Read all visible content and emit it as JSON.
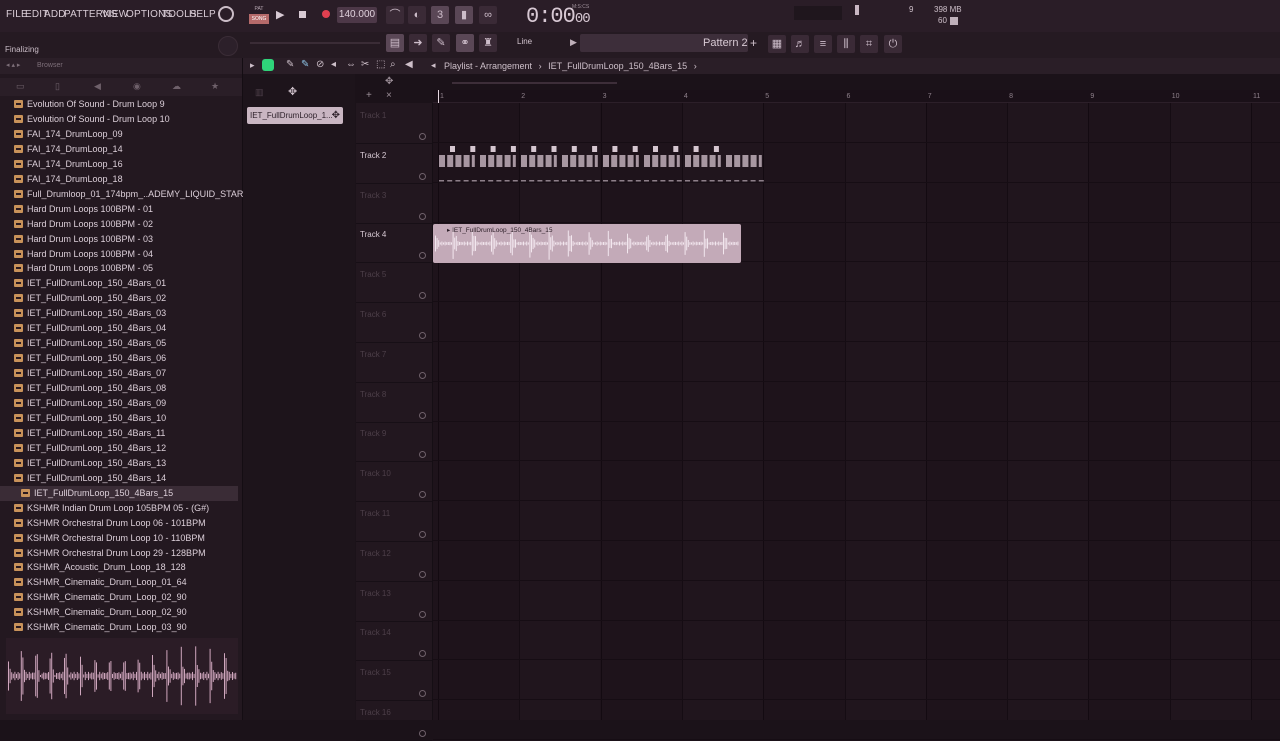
{
  "menu": [
    "FILE",
    "EDIT",
    "ADD",
    "PATTERNS",
    "VIEW",
    "OPTIONS",
    "TOOLS",
    "HELP"
  ],
  "mode": {
    "pat": "PAT",
    "song": "SONG"
  },
  "tempo": "140.000",
  "time": {
    "main": "0:00",
    "sub": "00",
    "label": "M:S:CS"
  },
  "meters": {
    "cpu": "9",
    "mem": "398 MB",
    "poly": "60"
  },
  "hint": "Finalizing",
  "snap": "Line",
  "pattern_name": "Pattern 2",
  "browser_label": "Browser",
  "browser_items": [
    "Evolution Of Sound - Drum Loop 9",
    "Evolution Of Sound - Drum Loop 10",
    "FAI_174_DrumLoop_09",
    "FAI_174_DrumLoop_14",
    "FAI_174_DrumLoop_16",
    "FAI_174_DrumLoop_18",
    "Full_Drumloop_01_174bpm_..ADEMY_LIQUID_STARTERKIT",
    "Hard Drum Loops 100BPM - 01",
    "Hard Drum Loops 100BPM - 02",
    "Hard Drum Loops 100BPM - 03",
    "Hard Drum Loops 100BPM - 04",
    "Hard Drum Loops 100BPM - 05",
    "IET_FullDrumLoop_150_4Bars_01",
    "IET_FullDrumLoop_150_4Bars_02",
    "IET_FullDrumLoop_150_4Bars_03",
    "IET_FullDrumLoop_150_4Bars_04",
    "IET_FullDrumLoop_150_4Bars_05",
    "IET_FullDrumLoop_150_4Bars_06",
    "IET_FullDrumLoop_150_4Bars_07",
    "IET_FullDrumLoop_150_4Bars_08",
    "IET_FullDrumLoop_150_4Bars_09",
    "IET_FullDrumLoop_150_4Bars_10",
    "IET_FullDrumLoop_150_4Bars_11",
    "IET_FullDrumLoop_150_4Bars_12",
    "IET_FullDrumLoop_150_4Bars_13",
    "IET_FullDrumLoop_150_4Bars_14",
    "IET_FullDrumLoop_150_4Bars_15",
    "KSHMR Indian Drum Loop 105BPM 05 - (G#)",
    "KSHMR Orchestral Drum Loop 06 - 101BPM",
    "KSHMR Orchestral Drum Loop 10 - 110BPM",
    "KSHMR Orchestral Drum Loop 29 - 128BPM",
    "KSHMR_Acoustic_Drum_Loop_18_128",
    "KSHMR_Cinematic_Drum_Loop_01_64",
    "KSHMR_Cinematic_Drum_Loop_02_90",
    "KSHMR_Cinematic_Drum_Loop_02_90",
    "KSHMR_Cinematic_Drum_Loop_03_90"
  ],
  "selected_index": 26,
  "pattern_chip": "IET_FullDrumLoop_1...",
  "playlist_title": "Playlist - Arrangement",
  "playlist_breadcrumb": "IET_FullDrumLoop_150_4Bars_15",
  "ruler": [
    "1",
    "2",
    "3",
    "4",
    "5",
    "6",
    "7",
    "8",
    "9",
    "10",
    "11"
  ],
  "tracks": [
    "Track 1",
    "Track 2",
    "Track 3",
    "Track 4",
    "Track 5",
    "Track 6",
    "Track 7",
    "Track 8",
    "Track 9",
    "Track 10",
    "Track 11",
    "Track 12",
    "Track 13",
    "Track 14",
    "Track 15",
    "Track 16"
  ],
  "active_tracks": [
    1,
    3
  ],
  "clip_track4": "IET_FullDrumLoop_150_4Bars_15",
  "colors": {
    "accent": "#c3aab8",
    "folder": "#c8925a",
    "record": "#e04050"
  }
}
